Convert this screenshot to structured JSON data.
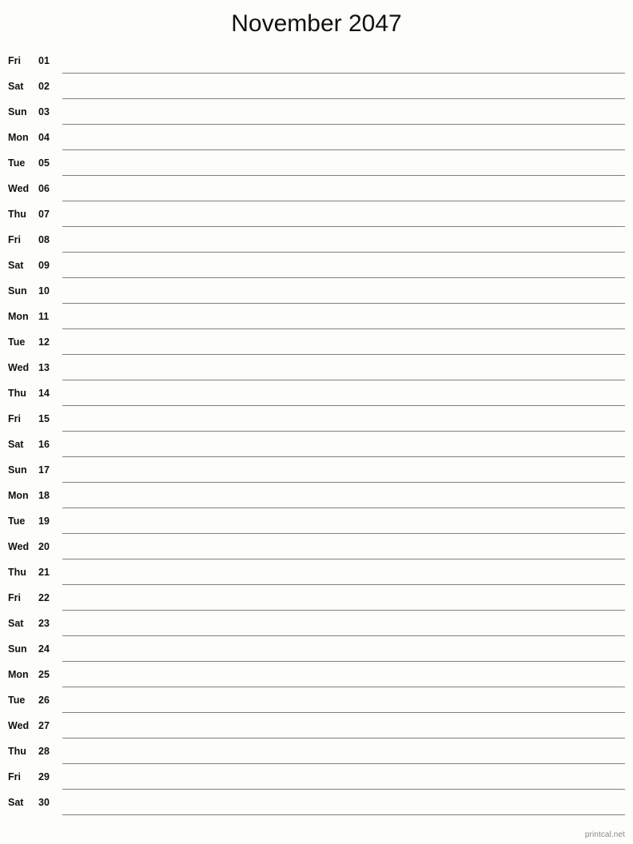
{
  "page": {
    "title": "November 2047",
    "month": "November",
    "year": "2047",
    "layout": "notes-column-single",
    "background_color": "#fdfdfa",
    "rule_color": "#808080",
    "text_color": "#111111",
    "footer_color": "#8a8a8a"
  },
  "footer": {
    "brand": "printcal.net"
  },
  "days": [
    {
      "weekday": "Fri",
      "day": "01"
    },
    {
      "weekday": "Sat",
      "day": "02"
    },
    {
      "weekday": "Sun",
      "day": "03"
    },
    {
      "weekday": "Mon",
      "day": "04"
    },
    {
      "weekday": "Tue",
      "day": "05"
    },
    {
      "weekday": "Wed",
      "day": "06"
    },
    {
      "weekday": "Thu",
      "day": "07"
    },
    {
      "weekday": "Fri",
      "day": "08"
    },
    {
      "weekday": "Sat",
      "day": "09"
    },
    {
      "weekday": "Sun",
      "day": "10"
    },
    {
      "weekday": "Mon",
      "day": "11"
    },
    {
      "weekday": "Tue",
      "day": "12"
    },
    {
      "weekday": "Wed",
      "day": "13"
    },
    {
      "weekday": "Thu",
      "day": "14"
    },
    {
      "weekday": "Fri",
      "day": "15"
    },
    {
      "weekday": "Sat",
      "day": "16"
    },
    {
      "weekday": "Sun",
      "day": "17"
    },
    {
      "weekday": "Mon",
      "day": "18"
    },
    {
      "weekday": "Tue",
      "day": "19"
    },
    {
      "weekday": "Wed",
      "day": "20"
    },
    {
      "weekday": "Thu",
      "day": "21"
    },
    {
      "weekday": "Fri",
      "day": "22"
    },
    {
      "weekday": "Sat",
      "day": "23"
    },
    {
      "weekday": "Sun",
      "day": "24"
    },
    {
      "weekday": "Mon",
      "day": "25"
    },
    {
      "weekday": "Tue",
      "day": "26"
    },
    {
      "weekday": "Wed",
      "day": "27"
    },
    {
      "weekday": "Thu",
      "day": "28"
    },
    {
      "weekday": "Fri",
      "day": "29"
    },
    {
      "weekday": "Sat",
      "day": "30"
    }
  ]
}
